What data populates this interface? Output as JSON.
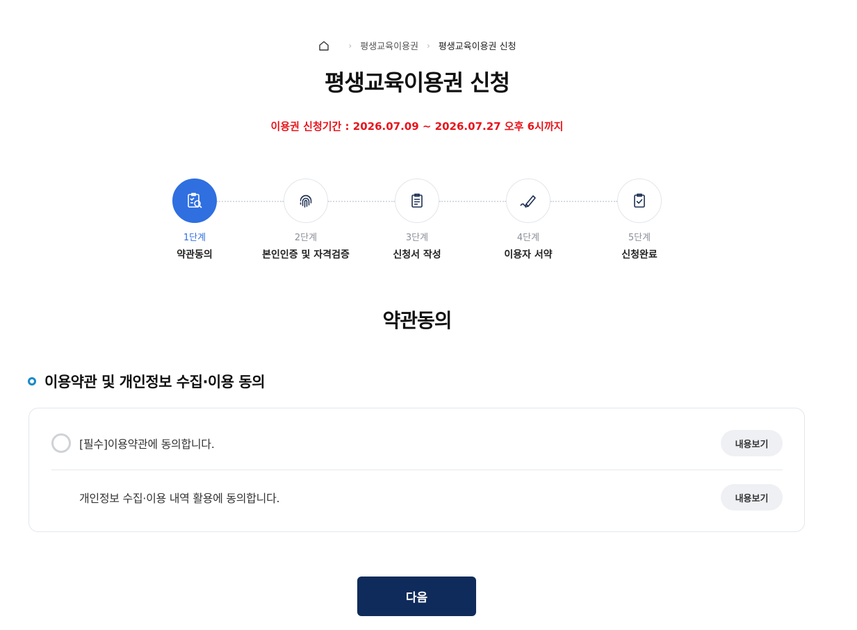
{
  "breadcrumb": {
    "items": [
      "평생교육이용권",
      "평생교육이용권 신청"
    ],
    "separator": "›"
  },
  "page_title": "평생교육이용권 신청",
  "period_text": "이용권 신청기간 : 2026.07.09 ~ 2026.07.27 오후 6시까지",
  "steps": [
    {
      "num": "1단계",
      "label": "약관동의",
      "icon": "clipboard-search-icon",
      "active": true
    },
    {
      "num": "2단계",
      "label": "본인인증 및 자격검증",
      "icon": "fingerprint-icon",
      "active": false
    },
    {
      "num": "3단계",
      "label": "신청서 작성",
      "icon": "document-icon",
      "active": false
    },
    {
      "num": "4단계",
      "label": "이용자 서약",
      "icon": "pen-icon",
      "active": false
    },
    {
      "num": "5단계",
      "label": "신청완료",
      "icon": "clipboard-check-icon",
      "active": false
    }
  ],
  "section_title": "약관동의",
  "sub_heading": "이용약관 및 개인정보 수집·이용 동의",
  "terms": [
    {
      "text": "[필수]이용약관에 동의합니다.",
      "button": "내용보기"
    },
    {
      "text": "개인정보 수집·이용 내역 활용에 동의합니다.",
      "button": "내용보기"
    }
  ],
  "next_button": "다음",
  "colors": {
    "accent": "#2f6fe0",
    "period": "#e8141b",
    "next_button_bg": "#0f2b5b",
    "bullet": "#1b89c9"
  }
}
